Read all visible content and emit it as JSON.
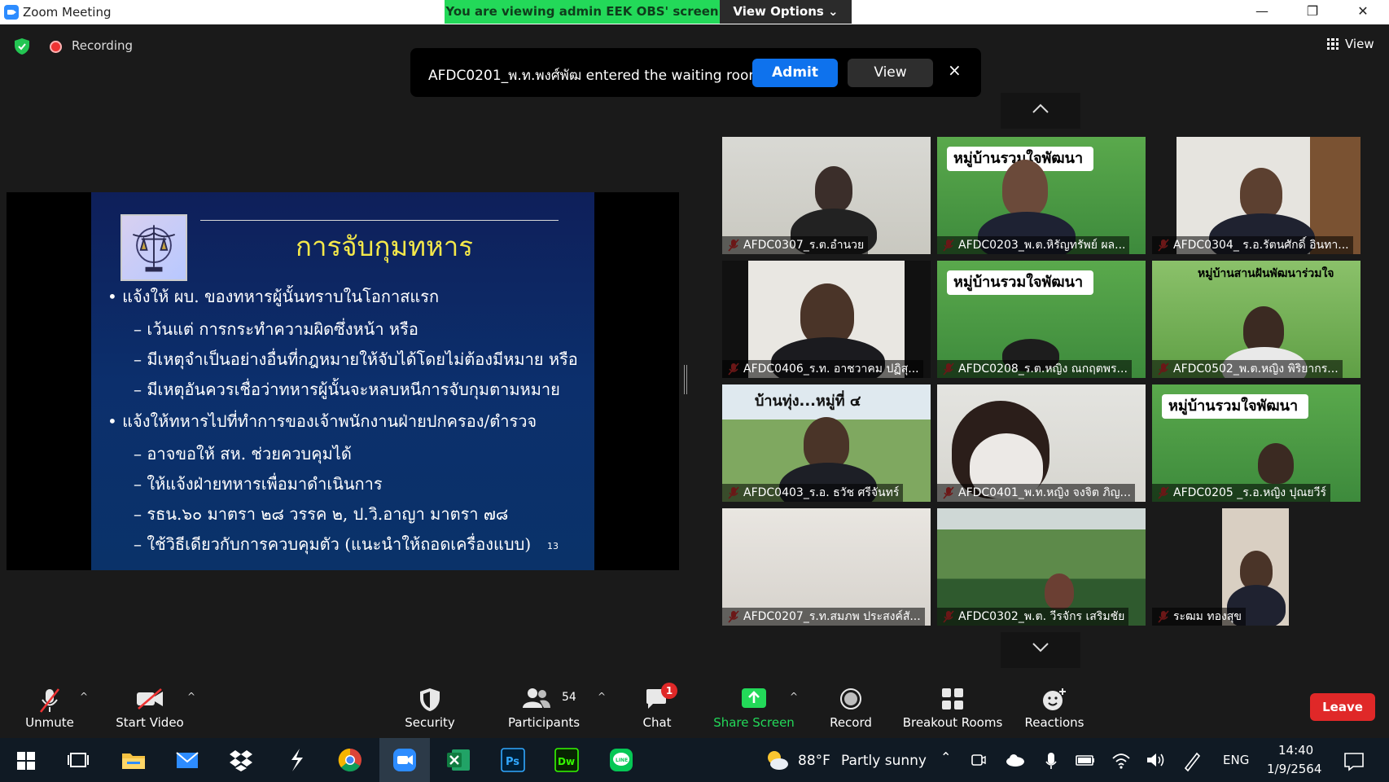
{
  "window": {
    "title": "Zoom Meeting",
    "viewing_banner": "You are viewing admin EEK OBS' screen",
    "view_options_label": "View Options",
    "controls": {
      "minimize": "—",
      "restore": "❐",
      "close": "✕"
    }
  },
  "meeting": {
    "recording_label": "Recording",
    "view_label": "View"
  },
  "notice": {
    "message": "AFDC0201_พ.ท.พงศ์พัฒ entered the waiting room",
    "admit_label": "Admit",
    "view_label": "View",
    "close_label": "×"
  },
  "slide": {
    "title": "การจับกุมทหาร",
    "page_number": "13",
    "lines": [
      "• แจ้งให้ ผบ. ของทหารผู้นั้นทราบในโอกาสแรก",
      "– เว้นแต่ การกระทำความผิดซึ่งหน้า หรือ",
      "– มีเหตุจำเป็นอย่างอื่นที่กฎหมายให้จับได้โดยไม่ต้องมีหมาย หรือ",
      "– มีเหตุอันควรเชื่อว่าทหารผู้นั้นจะหลบหนีการจับกุมตามหมาย",
      "• แจ้งให้ทหารไปที่ทำการของเจ้าพนักงานฝ่ายปกครอง/ตำรวจ",
      "– อาจขอให้ สห. ช่วยควบคุมได้",
      "– ให้แจ้งฝ่ายทหารเพื่อมาดำเนินการ",
      "– รธน.๖๐ มาตรา ๒๘ วรรค ๒, ป.วิ.อาญา มาตรา ๗๘",
      "– ใช้วิธีเดียวกับการควบคุมตัว (แนะนำให้ถอดเครื่องแบบ)"
    ]
  },
  "gallery": {
    "participants": [
      {
        "name": "AFDC0307_ร.ต.อำนวย"
      },
      {
        "name": "AFDC0203_พ.ต.หิรัญทรัพย์ ผล...",
        "banner": "หมู่บ้านรวมใจพัฒนา"
      },
      {
        "name": "AFDC0304_ ร.อ.รัตนศักดิ์ อินทา..."
      },
      {
        "name": "AFDC0406_ร.ท. อาชวาคม  ปฏิสุ..."
      },
      {
        "name": "AFDC0208_ร.ต.หญิง ณกฤตพร...",
        "banner": "หมู่บ้านรวมใจพัฒนา"
      },
      {
        "name": "AFDC0502_พ.ต.หญิง พิริยากร...",
        "banner": "หมู่บ้านสานฝันพัฒนาร่วมใจ"
      },
      {
        "name": "AFDC0403_ร.อ. ธวัช  ศรีจันทร์",
        "banner": "บ้านทุ่ง...หมู่ที่ ๔"
      },
      {
        "name": "AFDC0401_พ.ท.หญิง จงจิต ภิญ..."
      },
      {
        "name": "AFDC0205 _ร.อ.หญิง ปุณยวีร์",
        "banner": "หมู่บ้านรวมใจพัฒนา"
      },
      {
        "name": "AFDC0207_ร.ท.สมภพ ประสงค์สั..."
      },
      {
        "name": "AFDC0302_พ.ต. วีรจักร  เสริมชัย"
      },
      {
        "name": "ระฒม ทองสุข"
      }
    ]
  },
  "toolbar": {
    "unmute": "Unmute",
    "start_video": "Start Video",
    "security": "Security",
    "participants": "Participants",
    "participants_count": "54",
    "chat": "Chat",
    "chat_badge": "1",
    "share_screen": "Share Screen",
    "record": "Record",
    "breakout_rooms": "Breakout Rooms",
    "reactions": "Reactions",
    "leave": "Leave",
    "colors": {
      "share": "#23d959",
      "leave": "#e02828",
      "badge": "#e02828"
    }
  },
  "taskbar": {
    "weather_temp": "88°F",
    "weather_desc": "Partly sunny",
    "language": "ENG",
    "time": "14:40",
    "date": "1/9/2564",
    "apps": [
      "windows-start-icon",
      "task-view-icon",
      "file-explorer-icon",
      "mail-icon",
      "dropbox-icon",
      "app-s-icon",
      "chrome-icon",
      "zoom-icon",
      "excel-icon",
      "photoshop-icon",
      "dreamweaver-icon",
      "line-icon"
    ]
  }
}
